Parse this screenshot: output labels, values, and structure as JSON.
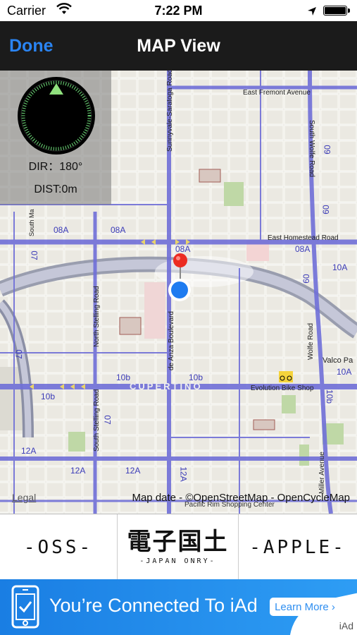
{
  "status_bar": {
    "carrier": "Carrier",
    "time": "7:22 PM",
    "battery_level": 1.0
  },
  "nav": {
    "back_label": "Done",
    "title": "MAP View"
  },
  "compass": {
    "direction": "DIR：180°",
    "distance": "DIST:0m"
  },
  "map": {
    "legal": "Legal",
    "attribution": "Map date - ©OpenStreetMap - OpenCycleMap",
    "labels": {
      "east_fremont": "East Fremont Avenue",
      "east_homestead": "East Homestead Road",
      "sunnyvale_saratoga": "Sunnyvale-Saratoga Road",
      "south_wolfe": "South Wolfe Road",
      "north_stelling": "North Stelling Road",
      "de_anza": "de Anza Boulevard",
      "wolfe": "Wolfe Road",
      "valco": "Valco Pa",
      "cupertino": "CUPERTINO",
      "evolution": "Evolution Bike Shop",
      "south_stelling": "South Stelling Road",
      "miller": "Miller Avenue",
      "pacific_rim": "Pacific Rim Shopping Center",
      "south_ma": "South Ma"
    },
    "route_tags": {
      "r08a_1": "08A",
      "r08a_2": "08A",
      "r08a_3": "08A",
      "r08a_4": "08A",
      "r09_1": "09",
      "r09_2": "09",
      "r09_3": "09",
      "r10a_1": "10A",
      "r10a_2": "10A",
      "r10b_1": "10b",
      "r10b_2": "10b",
      "r10b_3": "10b",
      "r10b_4": "10b",
      "r07_1": "07",
      "r07_2": "07",
      "r07_3": "07",
      "r12a_1": "12A",
      "r12a_2": "12A",
      "r12a_3": "12A",
      "r12a_4": "12A"
    }
  },
  "buttons": {
    "oss": "-OSS-",
    "japan_title": "電子国土",
    "japan_sub": "-JAPAN ONRY-",
    "apple": "-APPLE-"
  },
  "iad": {
    "headline": "You’re Connected To iAd",
    "cta": "Learn More ›",
    "badge": "iAd"
  }
}
